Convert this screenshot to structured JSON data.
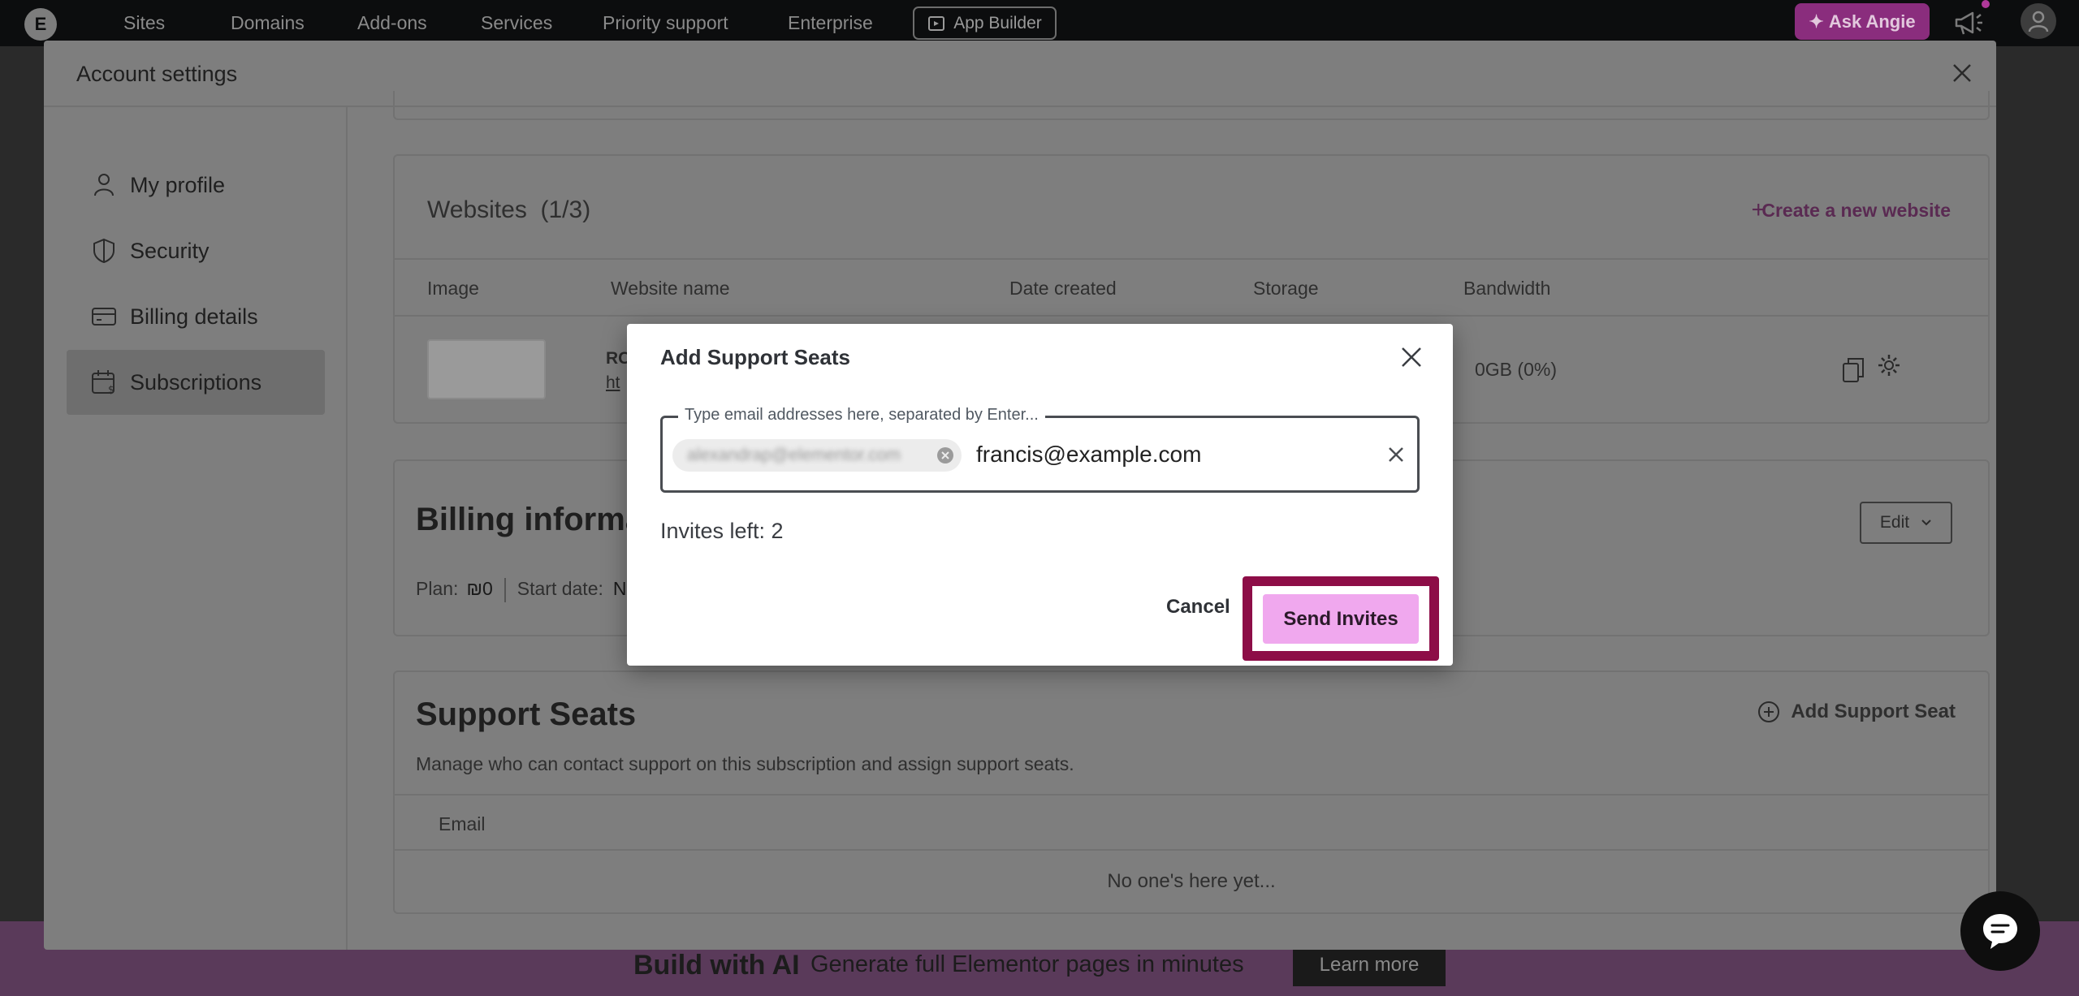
{
  "nav": {
    "logo_letter": "E",
    "items": [
      "Sites",
      "Domains",
      "Add-ons",
      "Services",
      "Priority support",
      "Enterprise"
    ],
    "app_builder": "App Builder",
    "ask_angie": "Ask Angie"
  },
  "panel": {
    "title": "Account settings",
    "sidebar": [
      {
        "label": "My profile",
        "icon": "person-icon"
      },
      {
        "label": "Security",
        "icon": "shield-icon"
      },
      {
        "label": "Billing details",
        "icon": "credit-card-icon"
      },
      {
        "label": "Subscriptions",
        "icon": "calendar-dollar-icon"
      }
    ],
    "active_sidebar": "Subscriptions"
  },
  "websites": {
    "title": "Websites",
    "count": "(1/3)",
    "create_label": "Create a new website",
    "columns": [
      "Image",
      "Website name",
      "Date created",
      "Storage",
      "Bandwidth"
    ],
    "row": {
      "name_prefix": "RC",
      "link_prefix": "ht",
      "bandwidth": "0GB (0%)"
    }
  },
  "billing": {
    "title": "Billing informa",
    "edit_label": "Edit",
    "plan_label": "Plan:",
    "plan_value": "₪0",
    "start_label": "Start date:",
    "start_value": "N"
  },
  "seats": {
    "title": "Support Seats",
    "add_label": "Add Support Seat",
    "description": "Manage who can contact support on this subscription and assign support seats.",
    "column": "Email",
    "empty": "No one's here yet..."
  },
  "banner": {
    "title": "Build with AI",
    "text": "Generate full Elementor pages in minutes",
    "button": "Learn more"
  },
  "dialog": {
    "title": "Add Support Seats",
    "field_label": "Type email addresses here, separated by Enter...",
    "chip_email": "alexandrap@elementor.com",
    "input_value": "francis@example.com",
    "invites_left": "Invites left: 2",
    "cancel": "Cancel",
    "send": "Send Invites"
  },
  "colors": {
    "accent": "#f0a8ee",
    "highlight": "#8d0d47",
    "ask_angie": "#8a2d7d"
  }
}
